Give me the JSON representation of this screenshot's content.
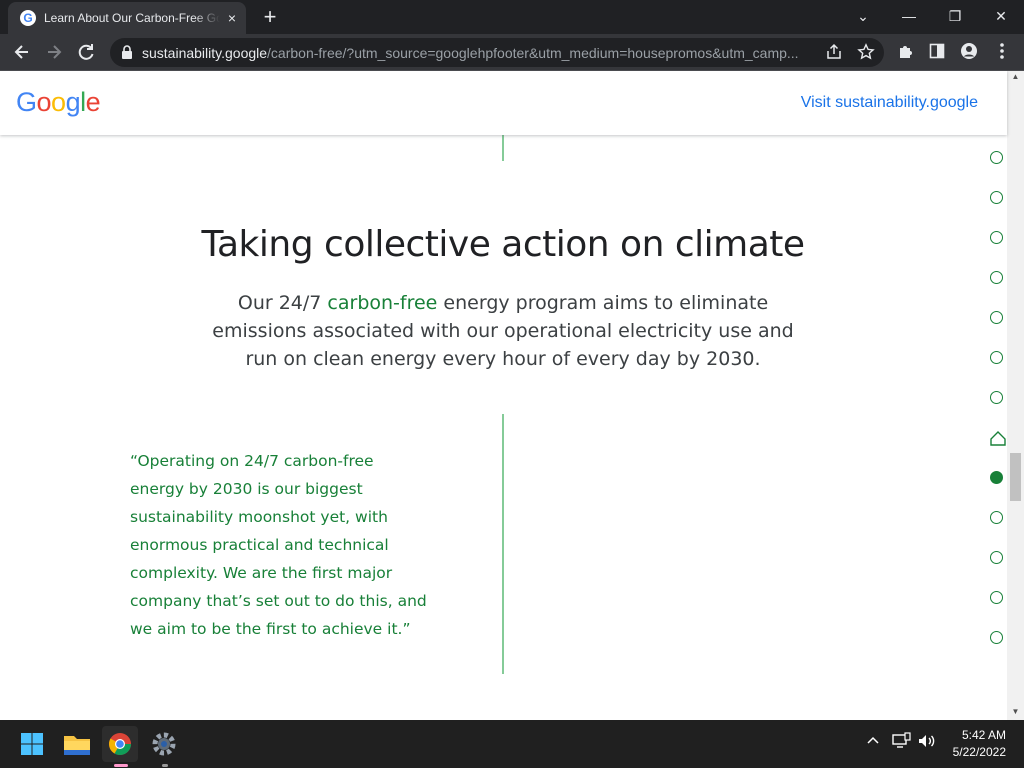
{
  "browser": {
    "tab_title": "Learn About Our Carbon-Free Goals",
    "favicon_letter": "G",
    "close_glyph": "×",
    "new_tab_glyph": "+",
    "url_host": "sustainability.google",
    "url_path": "/carbon-free/?utm_source=googlehpfooter&utm_medium=housepromos&utm_camp...",
    "window_controls": {
      "dropdown": "⌄",
      "minimize": "—",
      "restore": "❐",
      "close": "✕"
    }
  },
  "header": {
    "logo_letters": [
      {
        "char": "G",
        "color": "#4285F4"
      },
      {
        "char": "o",
        "color": "#EA4335"
      },
      {
        "char": "o",
        "color": "#FBBC05"
      },
      {
        "char": "g",
        "color": "#4285F4"
      },
      {
        "char": "l",
        "color": "#34A853"
      },
      {
        "char": "e",
        "color": "#EA4335"
      }
    ],
    "visit_link": "Visit sustainability.google"
  },
  "section": {
    "headline": "Taking collective action on climate",
    "lede_before": "Our 24/7 ",
    "lede_accent": "carbon-free",
    "lede_after": " energy program aims to eliminate emissions associated with our operational electricity use and run on clean energy every hour of every day by 2030.",
    "quote": "“Operating on 24/7 carbon-free energy by 2030 is our biggest sustainability moonshot yet, with enormous practical and technical complexity. We are the first major company that’s set out to do this, and we aim to be the first to achieve it.”"
  },
  "progress_nav": {
    "count": 13,
    "home_index": 7,
    "active_index": 8
  },
  "taskbar": {
    "time": "5:42 AM",
    "date": "5/22/2022",
    "tray_chevron": "^",
    "volume_glyph": "🔊"
  },
  "colors": {
    "accent_green": "#188038",
    "link_blue": "#1a73e8",
    "chrome_dark": "#202124",
    "chrome_mid": "#35363a"
  }
}
